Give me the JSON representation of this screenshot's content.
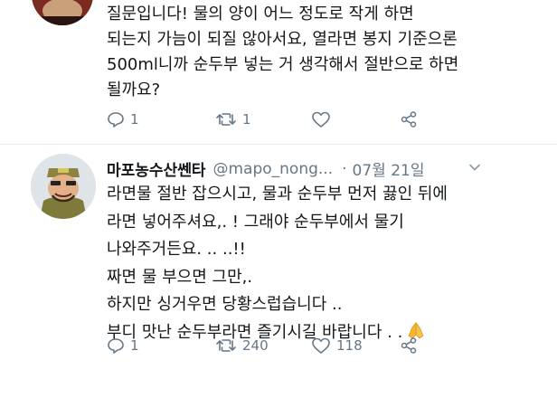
{
  "tweet1": {
    "lines": [
      "질문입니다! 물의 양이 어느 정도로 작게 하면",
      "되는지 가늠이 되질 않아서요, 열라면 봉지 기준으론",
      "500ml니까 순두부 넣는 거 생각해서 절반으로 하면",
      "될까요?"
    ],
    "reply_count": "1",
    "retweet_count": "1",
    "like_count": ""
  },
  "tweet2": {
    "display_name": "마포농수산쎈타",
    "handle": "@mapo_nong...",
    "separator": "·",
    "date": "07월 21일",
    "lines": [
      "라면물 절반 잡으시고, 물과 순두부 먼저 끓인 뒤에",
      "라면 넣어주셔요,. ! 그래야 순두부에서 물기",
      "나와주거든요. .. ..!!",
      "짜면 물 부으면 그만,.",
      "하지만 싱거우면 당황스럽습니다 ..",
      "부디 맛난 순두부라면 즐기시길 바랍니다 . ."
    ],
    "emoji": "folded-hands",
    "reply_count": "1",
    "retweet_count": "240",
    "like_count": "118"
  },
  "colors": {
    "text": "#14171a",
    "secondary": "#657786",
    "divider": "#e6ecf0",
    "emoji": "#f5b731"
  }
}
